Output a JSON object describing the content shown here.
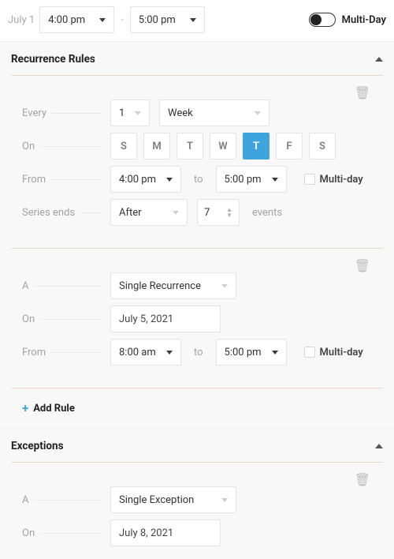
{
  "top": {
    "date_label": "July 1",
    "start": "4:00 pm",
    "end": "5:00 pm",
    "multi_day_label": "Multi-Day"
  },
  "recurrence": {
    "title": "Recurrence Rules",
    "rule1": {
      "every_label": "Every",
      "every_value": "1",
      "every_unit": "Week",
      "on_label": "On",
      "days": {
        "sun": "S",
        "mon": "M",
        "tue": "T",
        "wed": "W",
        "thu": "T",
        "fri": "F",
        "sat": "S"
      },
      "from_label": "From",
      "from_time": "4:00 pm",
      "to_label": "to",
      "to_time": "5:00 pm",
      "multiday_label": "Multi-day",
      "series_ends_label": "Series ends",
      "series_ends_mode": "After",
      "series_ends_count": "7",
      "series_ends_unit": "events"
    },
    "rule2": {
      "a_label": "A",
      "type": "Single Recurrence",
      "on_label": "On",
      "on_date": "July 5, 2021",
      "from_label": "From",
      "from_time": "8:00 am",
      "to_label": "to",
      "to_time": "5:00 pm",
      "multiday_label": "Multi-day"
    },
    "add_rule_label": "Add Rule"
  },
  "exceptions": {
    "title": "Exceptions",
    "rule1": {
      "a_label": "A",
      "type": "Single Exception",
      "on_label": "On",
      "on_date": "July 8, 2021"
    }
  }
}
